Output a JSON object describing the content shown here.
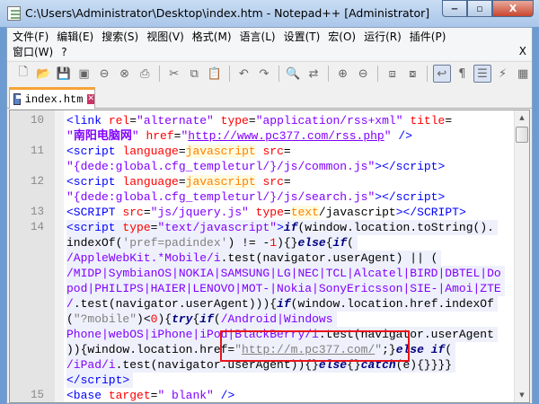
{
  "window": {
    "title": "C:\\Users\\Administrator\\Desktop\\index.htm - Notepad++ [Administrator]",
    "minimize": "‒",
    "maximize": "▫",
    "close": "X"
  },
  "menu": {
    "row1": [
      "文件(F)",
      "编辑(E)",
      "搜索(S)",
      "视图(V)",
      "格式(M)",
      "语言(L)",
      "设置(T)",
      "宏(O)",
      "运行(R)",
      "插件(P)"
    ],
    "row2": [
      "窗口(W)",
      "?"
    ],
    "close": "X"
  },
  "toolbar": [
    {
      "name": "new-file-icon",
      "g": "🗋"
    },
    {
      "name": "open-file-icon",
      "g": "📂"
    },
    {
      "name": "save-icon",
      "g": "💾"
    },
    {
      "name": "save-all-icon",
      "g": "▣"
    },
    {
      "name": "close-icon",
      "g": "⊖"
    },
    {
      "name": "close-all-icon",
      "g": "⊗"
    },
    {
      "name": "print-icon",
      "g": "⎙"
    },
    {
      "sep": true
    },
    {
      "name": "cut-icon",
      "g": "✂"
    },
    {
      "name": "copy-icon",
      "g": "⧉"
    },
    {
      "name": "paste-icon",
      "g": "📋"
    },
    {
      "sep": true
    },
    {
      "name": "undo-icon",
      "g": "↶"
    },
    {
      "name": "redo-icon",
      "g": "↷"
    },
    {
      "sep": true
    },
    {
      "name": "find-icon",
      "g": "🔍"
    },
    {
      "name": "replace-icon",
      "g": "⇄"
    },
    {
      "sep": true
    },
    {
      "name": "zoom-in-icon",
      "g": "⊕"
    },
    {
      "name": "zoom-out-icon",
      "g": "⊖"
    },
    {
      "sep": true
    },
    {
      "name": "sync-vertical-icon",
      "g": "⧈"
    },
    {
      "name": "sync-horizontal-icon",
      "g": "⧇"
    },
    {
      "sep": true
    },
    {
      "name": "word-wrap-icon",
      "g": "↩",
      "on": true
    },
    {
      "name": "show-all-chars-icon",
      "g": "¶"
    },
    {
      "name": "indent-guide-icon",
      "g": "☰",
      "on": true
    },
    {
      "name": "user-language-icon",
      "g": "⚡"
    },
    {
      "name": "document-map-icon",
      "g": "▦"
    }
  ],
  "tab": {
    "label": "index.htm",
    "close": "✕"
  },
  "code": [
    {
      "ln": "10",
      "seg": [
        [
          "t",
          "<link "
        ],
        [
          "a",
          "rel"
        ],
        [
          "p",
          "="
        ],
        [
          "v",
          "\"alternate\" "
        ],
        [
          "a",
          "type"
        ],
        [
          "p",
          "="
        ],
        [
          "v",
          "\"application/rss+xml\" "
        ],
        [
          "a",
          "title"
        ],
        [
          "p",
          "="
        ]
      ]
    },
    {
      "seg": [
        [
          "v",
          "\""
        ],
        [
          "vb",
          "南阳电脑网"
        ],
        [
          "v",
          "\" "
        ],
        [
          "a",
          "href"
        ],
        [
          "p",
          "="
        ],
        [
          "v",
          "\""
        ],
        [
          "u",
          "http://www.pc377.com/rss.php"
        ],
        [
          "v",
          "\" "
        ],
        [
          "t",
          "/>"
        ]
      ]
    },
    {
      "ln": "11",
      "seg": [
        [
          "t",
          "<script "
        ],
        [
          "a",
          "language"
        ],
        [
          "p",
          "="
        ],
        [
          "h",
          "javascript"
        ],
        [
          "a",
          " src"
        ],
        [
          "p",
          "="
        ]
      ]
    },
    {
      "seg": [
        [
          "v",
          "\"{dede:global.cfg_templeturl/}/js/common.js\""
        ],
        [
          "t",
          "></script>"
        ]
      ]
    },
    {
      "ln": "12",
      "seg": [
        [
          "t",
          "<script "
        ],
        [
          "a",
          "language"
        ],
        [
          "p",
          "="
        ],
        [
          "h",
          "javascript"
        ],
        [
          "a",
          " src"
        ],
        [
          "p",
          "="
        ]
      ]
    },
    {
      "seg": [
        [
          "v",
          "\"{dede:global.cfg_templeturl/}/js/search.js\""
        ],
        [
          "t",
          "></script>"
        ]
      ]
    },
    {
      "ln": "13",
      "seg": [
        [
          "t",
          "<SCRIPT "
        ],
        [
          "a",
          "src"
        ],
        [
          "p",
          "="
        ],
        [
          "v",
          "\"js/jquery.js\" "
        ],
        [
          "a",
          "type"
        ],
        [
          "p",
          "="
        ],
        [
          "h",
          "text"
        ],
        [
          "p",
          "/javascript"
        ],
        [
          "t",
          "></SCRIPT>"
        ]
      ]
    },
    {
      "ln": "14",
      "seg": [
        [
          "t",
          "<script "
        ],
        [
          "a",
          "type"
        ],
        [
          "p",
          "="
        ],
        [
          "v",
          "\"text/javascript\""
        ],
        [
          "t",
          ">"
        ],
        [
          "k",
          "if"
        ],
        [
          "p",
          "(window.location.toString()."
        ]
      ],
      "js": true
    },
    {
      "seg": [
        [
          "p",
          "indexOf("
        ],
        [
          "s",
          "'pref=padindex'"
        ],
        [
          "p",
          ") != -"
        ],
        [
          "n",
          "1"
        ],
        [
          "p",
          "){}"
        ],
        [
          "k",
          "else"
        ],
        [
          "p",
          "{"
        ],
        [
          "k",
          "if"
        ],
        [
          "p",
          "("
        ]
      ],
      "js": true
    },
    {
      "seg": [
        [
          "r",
          "/AppleWebKit.*Mobile/i"
        ],
        [
          "p",
          ".test(navigator.userAgent) || ("
        ]
      ],
      "js": true
    },
    {
      "seg": [
        [
          "r",
          "/MIDP|SymbianOS|NOKIA|SAMSUNG|LG|NEC|TCL|Alcatel|BIRD|DBTEL|Do"
        ]
      ],
      "js": true
    },
    {
      "seg": [
        [
          "r",
          "pod|PHILIPS|HAIER|LENOVO|MOT-|Nokia|SonyEricsson|SIE-|Amoi|ZTE"
        ]
      ],
      "js": true
    },
    {
      "seg": [
        [
          "r",
          "/"
        ],
        [
          "p",
          ".test(navigator.userAgent))){"
        ],
        [
          "k",
          "if"
        ],
        [
          "p",
          "(window.location.href.indexOf"
        ]
      ],
      "js": true
    },
    {
      "seg": [
        [
          "p",
          "("
        ],
        [
          "s",
          "\"?mobile\""
        ],
        [
          "p",
          ")<"
        ],
        [
          "n",
          "0"
        ],
        [
          "p",
          "){"
        ],
        [
          "k",
          "try"
        ],
        [
          "p",
          "{"
        ],
        [
          "k",
          "if"
        ],
        [
          "p",
          "("
        ],
        [
          "r",
          "/Android|Windows"
        ]
      ],
      "js": true
    },
    {
      "seg": [
        [
          "r",
          "Phone|webOS|iPhone|iPod|BlackBerry/i"
        ],
        [
          "p",
          ".test(navigator.userAgent"
        ]
      ],
      "js": true
    },
    {
      "seg": [
        [
          "p",
          ")){window.location.href="
        ],
        [
          "s",
          "\""
        ],
        [
          "su",
          "http://m.pc377.com/"
        ],
        [
          "s",
          "\""
        ],
        [
          "p",
          ";}"
        ],
        [
          "k",
          "else if"
        ],
        [
          "p",
          "("
        ]
      ],
      "js": true
    },
    {
      "seg": [
        [
          "r",
          "/iPad/i"
        ],
        [
          "p",
          ".test(navigator.userAgent)){}"
        ],
        [
          "k",
          "else"
        ],
        [
          "p",
          "{}"
        ],
        [
          "k",
          "catch"
        ],
        [
          "p",
          "(e){}}}}"
        ]
      ],
      "js": true
    },
    {
      "seg": [
        [
          "t",
          "</script>"
        ]
      ],
      "js": true
    },
    {
      "ln": "15",
      "seg": [
        [
          "t",
          "<base "
        ],
        [
          "a",
          "target"
        ],
        [
          "p",
          "="
        ],
        [
          "v",
          "\" blank\" "
        ],
        [
          "t",
          "/>"
        ]
      ]
    }
  ]
}
